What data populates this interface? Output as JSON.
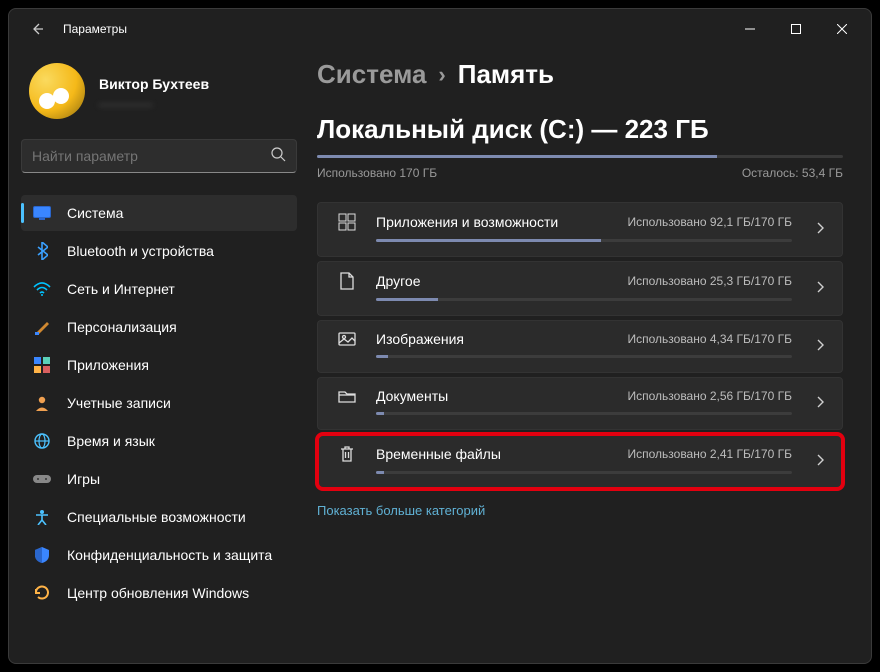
{
  "title": "Параметры",
  "profile": {
    "name": "Виктор Бухтеев",
    "sub": "________"
  },
  "search": {
    "placeholder": "Найти параметр"
  },
  "nav": [
    {
      "label": "Система",
      "icon": "display",
      "active": true
    },
    {
      "label": "Bluetooth и устройства",
      "icon": "bluetooth"
    },
    {
      "label": "Сеть и Интернет",
      "icon": "wifi"
    },
    {
      "label": "Персонализация",
      "icon": "brush"
    },
    {
      "label": "Приложения",
      "icon": "apps"
    },
    {
      "label": "Учетные записи",
      "icon": "person"
    },
    {
      "label": "Время и язык",
      "icon": "globe"
    },
    {
      "label": "Игры",
      "icon": "gamepad"
    },
    {
      "label": "Специальные возможности",
      "icon": "accessibility"
    },
    {
      "label": "Конфиденциальность и защита",
      "icon": "shield"
    },
    {
      "label": "Центр обновления Windows",
      "icon": "update"
    }
  ],
  "breadcrumb": {
    "parent": "Система",
    "current": "Память"
  },
  "disk": {
    "title": "Локальный диск (C:) — 223 ГБ",
    "used_label": "Использовано 170 ГБ",
    "remaining_label": "Осталось: 53,4 ГБ",
    "used_pct": 76
  },
  "cards": [
    {
      "label": "Приложения и возможности",
      "usage": "Использовано 92,1 ГБ/170 ГБ",
      "pct": 54,
      "icon": "appsgrid"
    },
    {
      "label": "Другое",
      "usage": "Использовано 25,3 ГБ/170 ГБ",
      "pct": 15,
      "icon": "file"
    },
    {
      "label": "Изображения",
      "usage": "Использовано 4,34 ГБ/170 ГБ",
      "pct": 3,
      "icon": "image"
    },
    {
      "label": "Документы",
      "usage": "Использовано 2,56 ГБ/170 ГБ",
      "pct": 2,
      "icon": "folder"
    },
    {
      "label": "Временные файлы",
      "usage": "Использовано 2,41 ГБ/170 ГБ",
      "pct": 2,
      "icon": "trash",
      "highlight": true
    }
  ],
  "more_link": "Показать больше категорий"
}
